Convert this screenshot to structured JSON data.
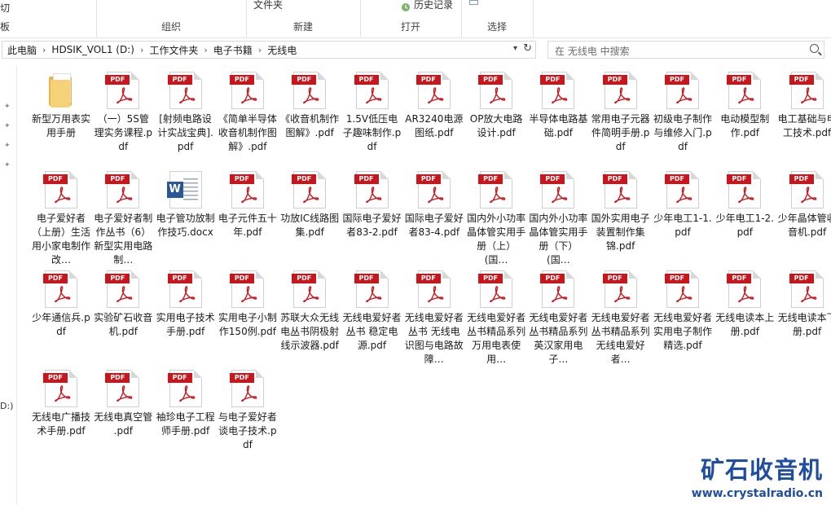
{
  "ribbon": {
    "left_fragment_top": "切",
    "left_fragment_bottom": "板",
    "groups": [
      {
        "label": "组织"
      },
      {
        "label": "新建",
        "item": "文件夹"
      },
      {
        "label": "打开",
        "item": "历史记录"
      },
      {
        "label": "选择"
      }
    ]
  },
  "address": {
    "crumbs": [
      "此电脑",
      "HDSIK_VOL1 (D:)",
      "工作文件夹",
      "电子书籍",
      "无线电"
    ]
  },
  "search": {
    "placeholder": "在 无线电 中搜索"
  },
  "nav": {
    "drive_fragment": "D:)"
  },
  "files": [
    {
      "name": "新型万用表实用手册",
      "type": "folder"
    },
    {
      "name": "（一）5S管理实务课程.pdf",
      "type": "pdf"
    },
    {
      "name": "[射频电路设计实战宝典].pdf",
      "type": "pdf"
    },
    {
      "name": "《简单半导体收音机制作图解》.pdf",
      "type": "pdf"
    },
    {
      "name": "《收音机制作图解》.pdf",
      "type": "pdf"
    },
    {
      "name": "1.5V低压电子趣味制作.pdf",
      "type": "pdf"
    },
    {
      "name": "AR3240电源图纸.pdf",
      "type": "pdf"
    },
    {
      "name": "OP放大电路设计.pdf",
      "type": "pdf"
    },
    {
      "name": "半导体电路基础.pdf",
      "type": "pdf"
    },
    {
      "name": "常用电子元器件简明手册.pdf",
      "type": "pdf"
    },
    {
      "name": "初级电子制作与维修入门.pdf",
      "type": "pdf"
    },
    {
      "name": "电动模型制作.pdf",
      "type": "pdf"
    },
    {
      "name": "电工基础与电工技术.pdf",
      "type": "pdf"
    },
    {
      "name": "电子爱好者（上册）生活用小家电制作改…",
      "type": "pdf"
    },
    {
      "name": "电子爱好者制作丛书（6） 新型实用电路制…",
      "type": "pdf"
    },
    {
      "name": "电子管功放制作技巧.docx",
      "type": "docx"
    },
    {
      "name": "电子元件五十年.pdf",
      "type": "pdf"
    },
    {
      "name": "功放IC线路图集.pdf",
      "type": "pdf"
    },
    {
      "name": "国际电子爱好者83-2.pdf",
      "type": "pdf"
    },
    {
      "name": "国际电子爱好者83-4.pdf",
      "type": "pdf"
    },
    {
      "name": "国内外小功率晶体管实用手册（上） (国…",
      "type": "pdf"
    },
    {
      "name": "国内外小功率晶体管实用手册（下） (国…",
      "type": "pdf"
    },
    {
      "name": "国外实用电子装置制作集锦.pdf",
      "type": "pdf"
    },
    {
      "name": "少年电工1-1.pdf",
      "type": "pdf"
    },
    {
      "name": "少年电工1-2.pdf",
      "type": "pdf"
    },
    {
      "name": "少年晶体管收音机.pdf",
      "type": "pdf"
    },
    {
      "name": "少年通信兵.pdf",
      "type": "pdf"
    },
    {
      "name": "实验矿石收音机.pdf",
      "type": "pdf"
    },
    {
      "name": "实用电子技术手册.pdf",
      "type": "pdf"
    },
    {
      "name": "实用电子小制作150例.pdf",
      "type": "pdf"
    },
    {
      "name": "苏联大众无线电丛书阴极射线示波器.pdf",
      "type": "pdf"
    },
    {
      "name": "无线电爱好者丛书 稳定电源.pdf",
      "type": "pdf"
    },
    {
      "name": "无线电爱好者丛书 无线电识图与电路故障…",
      "type": "pdf"
    },
    {
      "name": "无线电爱好者丛书精品系列 万用电表使用…",
      "type": "pdf"
    },
    {
      "name": "无线电爱好者丛书精品系列 英汉家用电子…",
      "type": "pdf"
    },
    {
      "name": "无线电爱好者丛书精品系列 无线电爱好者…",
      "type": "pdf"
    },
    {
      "name": "无线电爱好者实用电子制作精选.pdf",
      "type": "pdf"
    },
    {
      "name": "无线电读本上册.pdf",
      "type": "pdf"
    },
    {
      "name": "无线电读本下册.pdf",
      "type": "pdf"
    },
    {
      "name": "无线电广播技术手册.pdf",
      "type": "pdf"
    },
    {
      "name": "无线电真空管 .pdf",
      "type": "pdf"
    },
    {
      "name": "袖珍电子工程师手册.pdf",
      "type": "pdf"
    },
    {
      "name": "与电子爱好者谈电子技术.pdf",
      "type": "pdf"
    }
  ],
  "pdf_badge": "PDF",
  "docx_badge": "W",
  "watermark": {
    "title": "矿石收音机",
    "url": "www.crystalradio.cn"
  },
  "colors": {
    "pdf_red": "#c8161d",
    "word_blue": "#2b5797",
    "watermark_blue": "#1f4ea1",
    "folder_yellow": "#e8b54d"
  }
}
